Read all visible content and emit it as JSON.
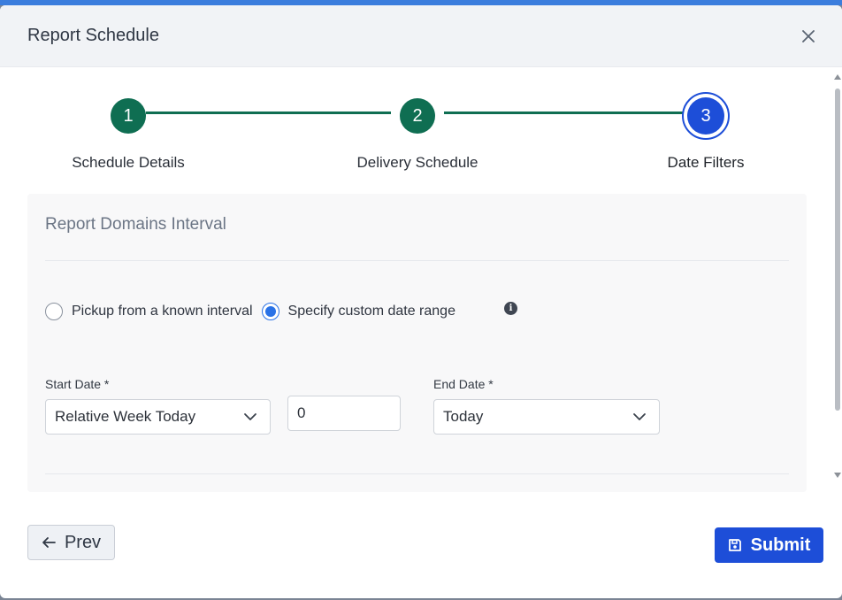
{
  "modal": {
    "title": "Report Schedule"
  },
  "stepper": {
    "steps": [
      {
        "number": "1",
        "label": "Schedule Details",
        "state": "complete"
      },
      {
        "number": "2",
        "label": "Delivery Schedule",
        "state": "complete"
      },
      {
        "number": "3",
        "label": "Date Filters",
        "state": "active"
      }
    ]
  },
  "panel": {
    "title": "Report Domains Interval",
    "radio_known": "Pickup from a known interval",
    "radio_custom": "Specify custom date range",
    "selected_radio": "custom",
    "start_date": {
      "label": "Start Date *",
      "value": "Relative Week Today"
    },
    "offset_value": "0",
    "end_date": {
      "label": "End Date *",
      "value": "Today"
    }
  },
  "footer": {
    "prev_label": "Prev",
    "submit_label": "Submit"
  },
  "colors": {
    "step_complete": "#0f6e52",
    "step_active": "#1d4ed8",
    "submit": "#1d4ed8",
    "radio_checked": "#2a72e6"
  },
  "icons": {
    "close": "close-icon",
    "info": "info-icon",
    "prev": "arrow-left-icon",
    "submit": "save-icon",
    "dropdown": "chevron-down-icon"
  }
}
